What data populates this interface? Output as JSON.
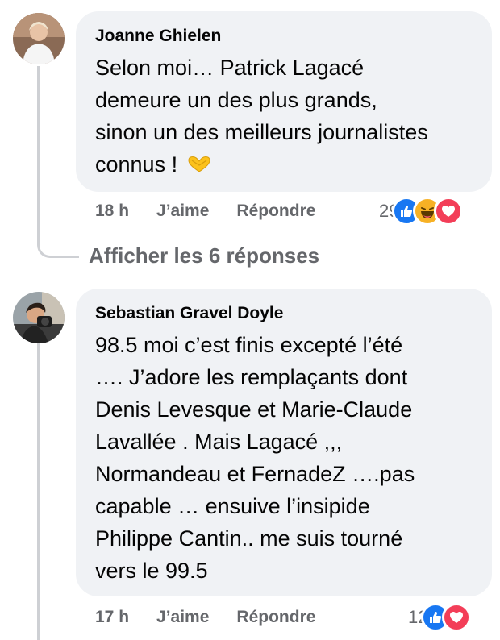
{
  "comments": [
    {
      "author": "Joanne Ghielen",
      "text": "Selon moi… Patrick Lagacé\ndemeure un des plus grands,\nsinon un des meilleurs journalistes\nconnus ! ",
      "emoji": "heart-hands-icon",
      "time": "18 h",
      "like_label": "J’aime",
      "reply_label": "Répondre",
      "reaction_count": "29",
      "reactions": [
        "like",
        "haha",
        "love"
      ]
    },
    {
      "author": "Sebastian Gravel Doyle",
      "text": "98.5 moi c’est finis excepté l’été\n…. J’adore les remplaçants dont\nDenis Levesque et Marie-Claude\nLavallée . Mais Lagacé ,,,\nNormandeau et FernadeZ ….pas\ncapable … ensuive l’insipide\nPhilippe Cantin.. me suis tourné\nvers le 99.5",
      "time": "17 h",
      "like_label": "J’aime",
      "reply_label": "Répondre",
      "reaction_count": "12",
      "reactions": [
        "like",
        "love"
      ]
    }
  ],
  "view_replies_label": "Afficher les 6 réponses",
  "colors": {
    "bubble": "#f0f2f5",
    "meta_text": "#65676b",
    "like_blue": "#1877f2",
    "love_red": "#f33e58",
    "haha_yellow": "#f7b125"
  }
}
